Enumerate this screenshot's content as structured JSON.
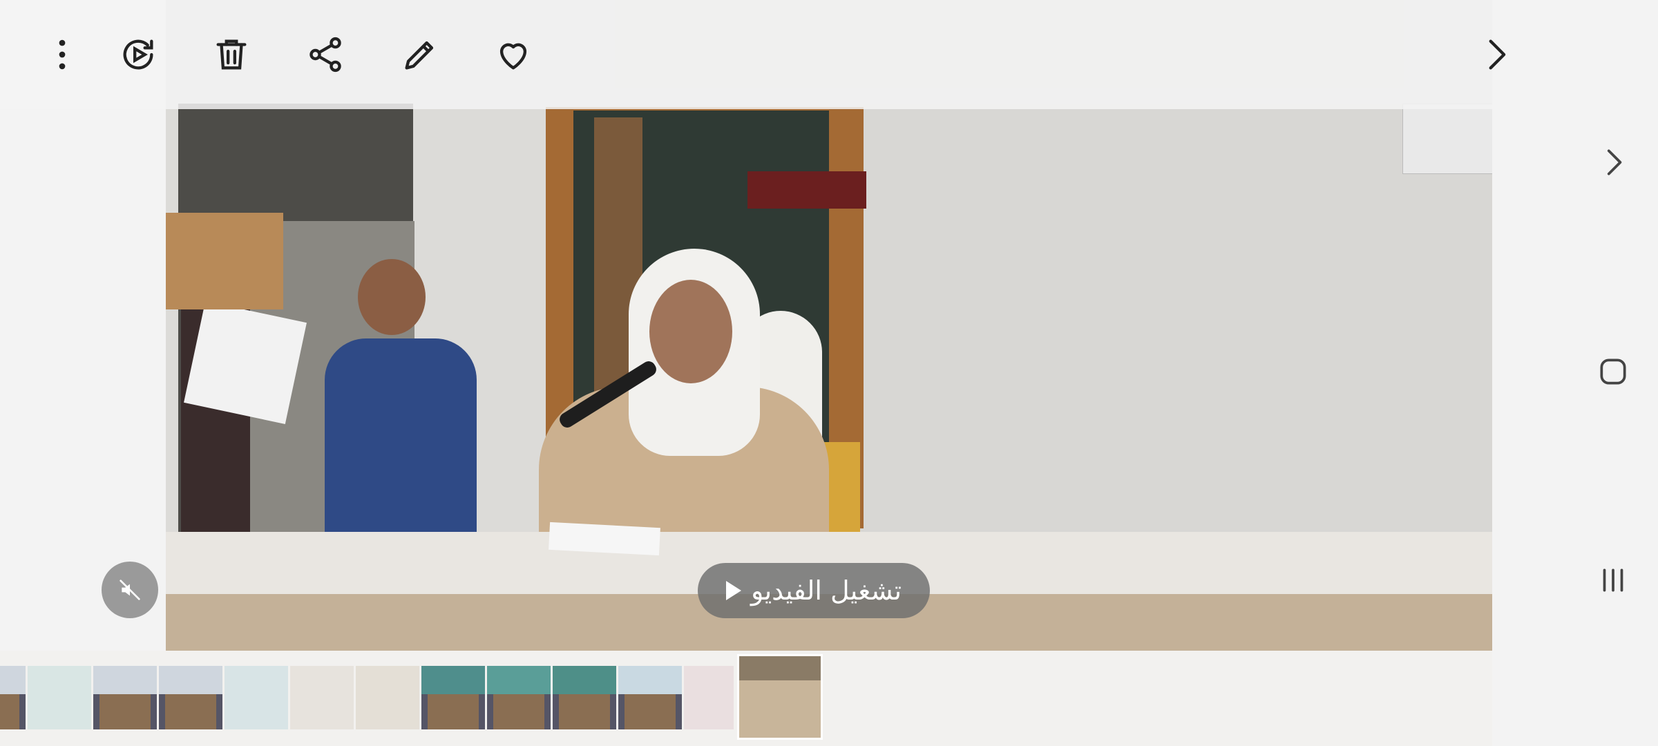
{
  "toolbar": {
    "icons": [
      "more-options-icon",
      "motion-photo-icon",
      "delete-icon",
      "share-icon",
      "edit-icon",
      "favorite-icon"
    ]
  },
  "player": {
    "play_label": "تشغيل الفيديو",
    "mute_icon": "mute-icon"
  },
  "navigation": {
    "next_icon": "chevron-right-icon"
  },
  "system_nav": {
    "icons": [
      "chevron-right-icon",
      "home-square-icon",
      "recents-icon"
    ]
  },
  "filmstrip": {
    "thumbnail_count": 13,
    "selected_index": 12
  }
}
